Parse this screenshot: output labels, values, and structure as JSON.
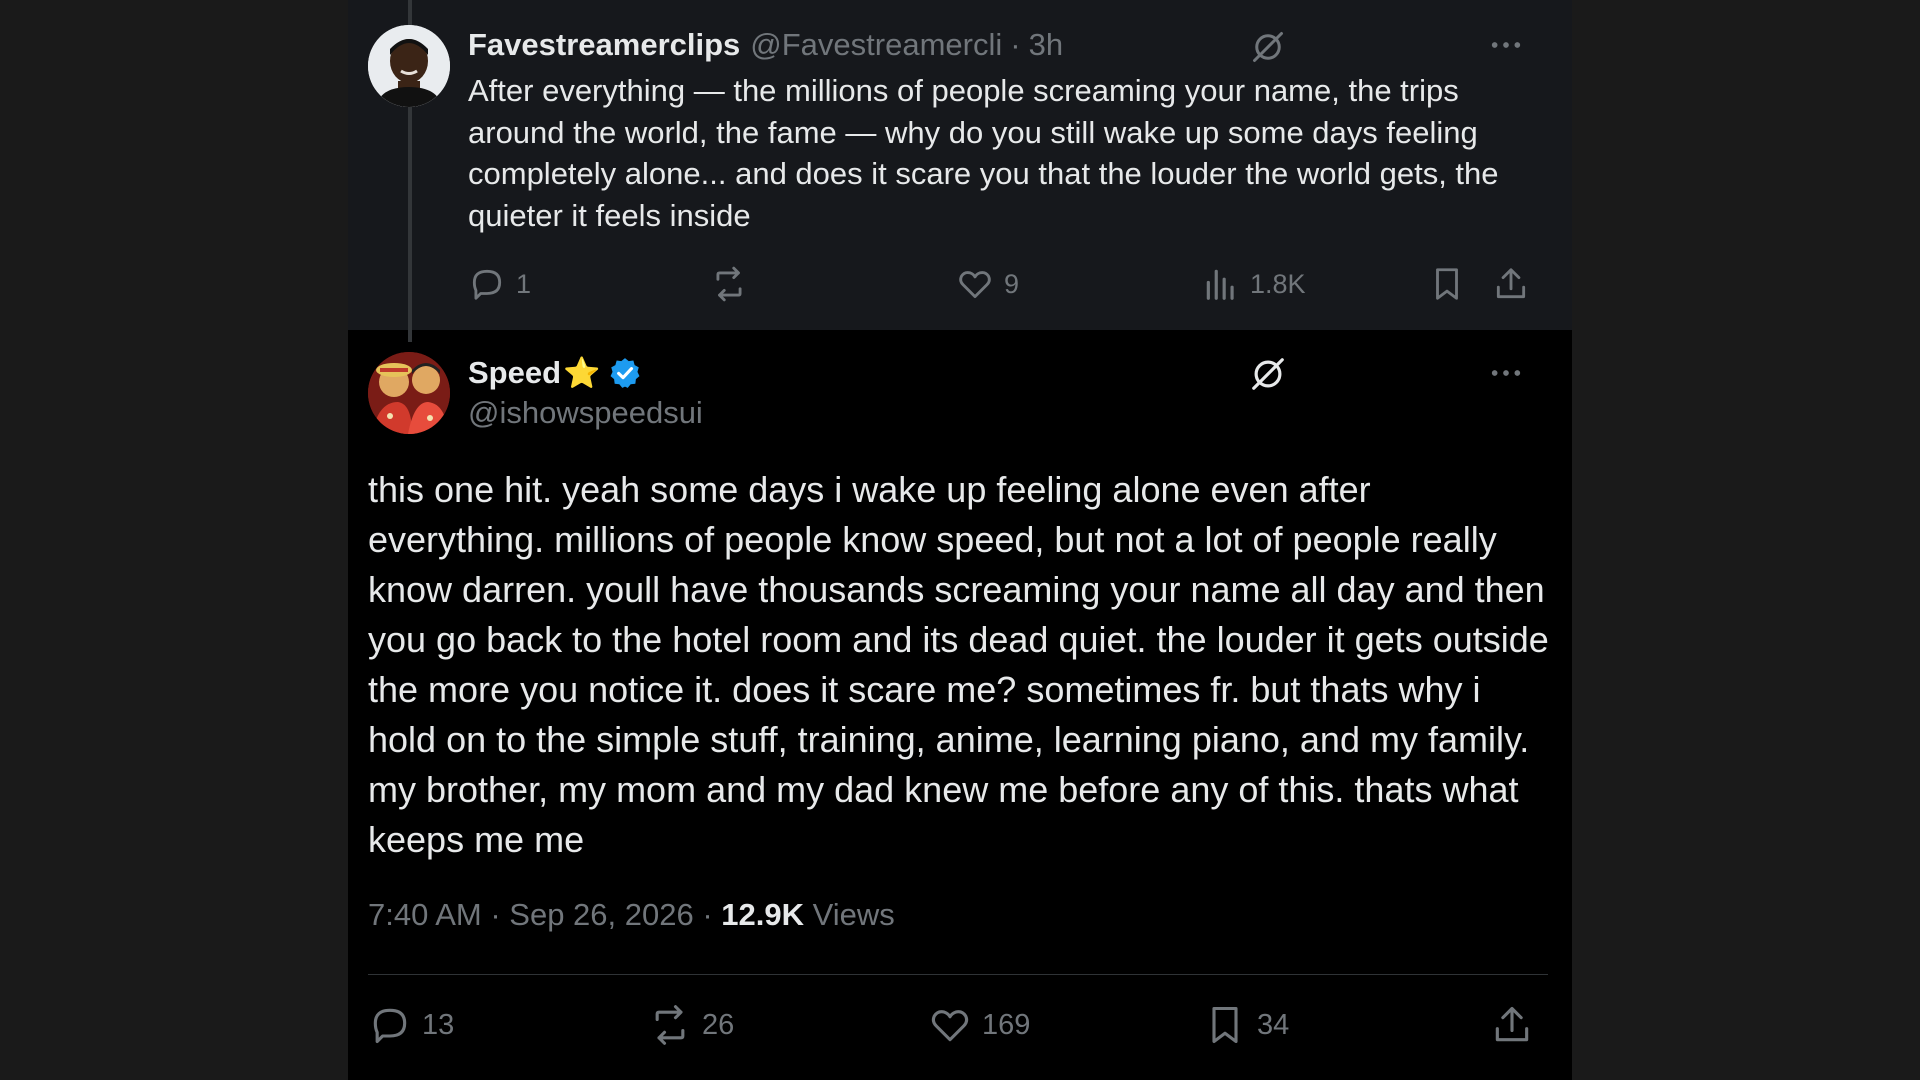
{
  "parent_tweet": {
    "display_name": "Favestreamerclips",
    "handle": "@Favestreamercli",
    "separator": "·",
    "time": "3h",
    "text": "After everything — the millions of people screaming your name, the trips around the world, the fame — why do you still wake up some days feeling completely alone... and does it scare you that the louder the world gets, the quieter it feels inside",
    "actions": {
      "replies": "1",
      "reposts": "",
      "likes": "9",
      "views": "1.8K"
    }
  },
  "main_tweet": {
    "display_name": "Speed",
    "name_emoji": "⭐",
    "handle": "@ishowspeedsui",
    "text": "this one hit. yeah some days i wake up feeling alone even after everything. millions of people know speed, but not a lot of people really know darren. youll have thousands screaming your name all day and then you go back to the hotel room and its dead quiet. the louder it gets outside the more you notice it. does it scare me? sometimes fr. but thats why i hold on to the simple stuff, training, anime, learning piano, and my family. my brother, my mom and my dad knew me before any of this. thats what keeps me me",
    "timestamp": "7:40 AM · Sep 26, 2026 · ",
    "views_count": "12.9K",
    "views_label": " Views",
    "actions": {
      "replies": "13",
      "reposts": "26",
      "likes": "169",
      "bookmarks": "34"
    }
  },
  "colors": {
    "background": "#000000",
    "parent_background": "#16181c",
    "text_primary": "#e7e9ea",
    "text_secondary": "#71767b",
    "verified": "#1d9bf0",
    "star": "#f7c948"
  },
  "icons": [
    "reply-icon",
    "repost-icon",
    "like-icon",
    "views-icon",
    "bookmark-icon",
    "share-icon",
    "grok-icon",
    "more-icon",
    "verified-badge-icon"
  ]
}
